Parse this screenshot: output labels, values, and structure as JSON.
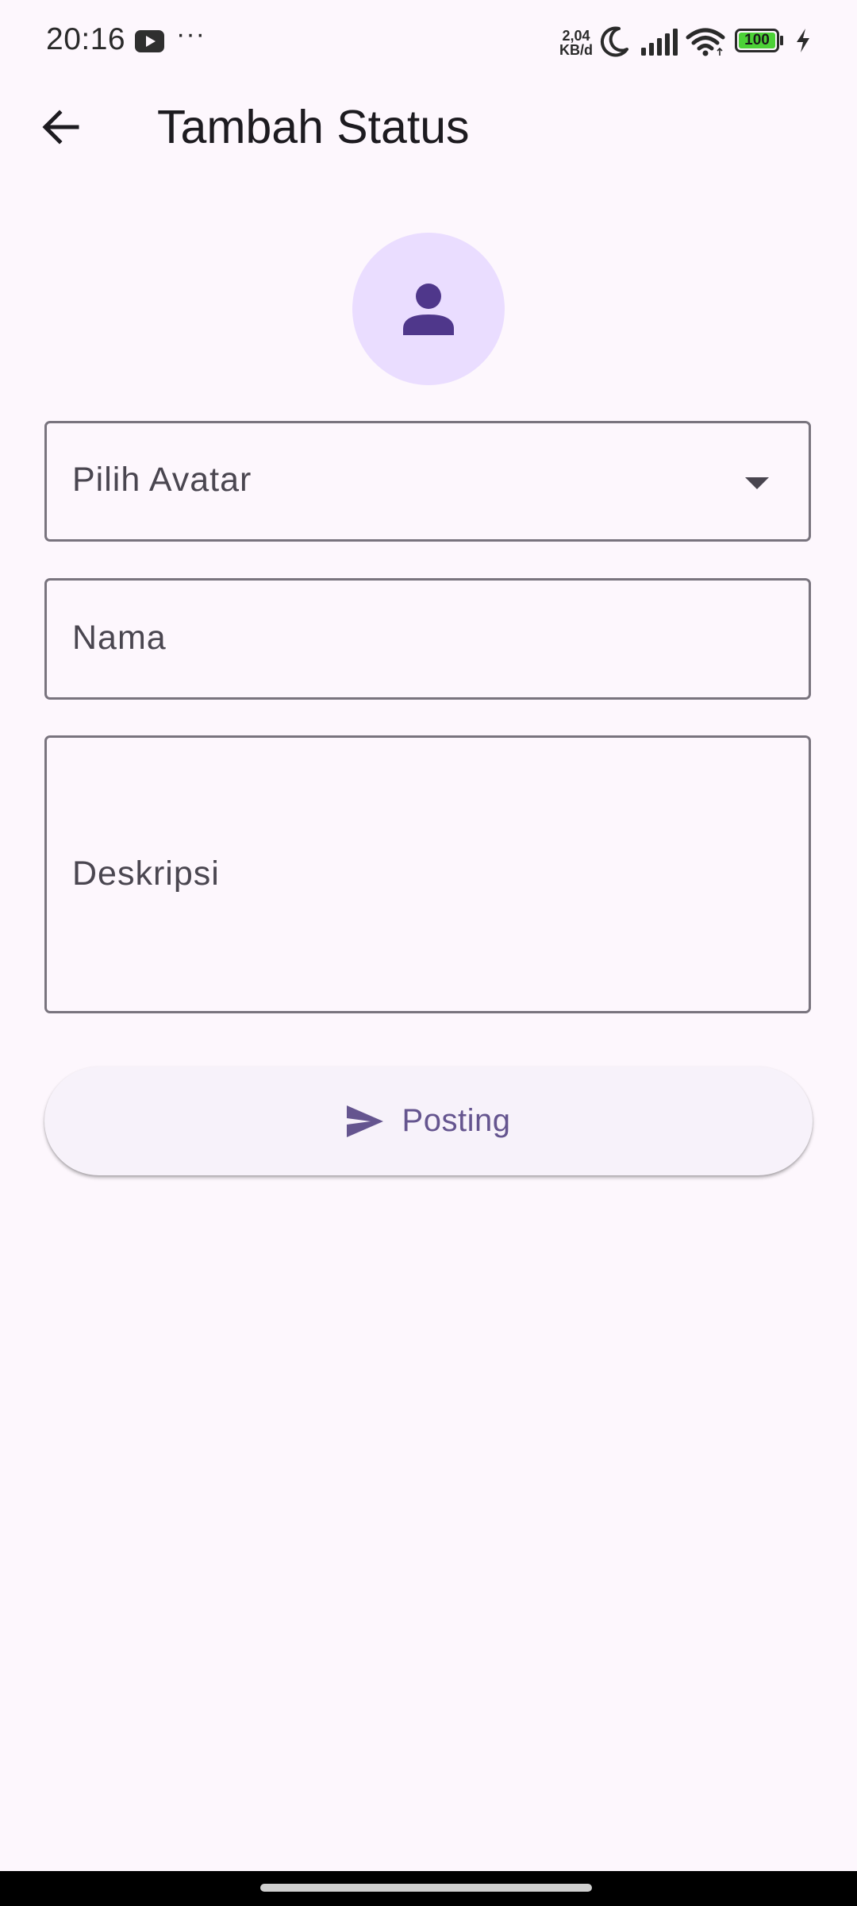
{
  "status_bar": {
    "time": "20:16",
    "more": "···",
    "net_speed_value": "2,04",
    "net_speed_unit": "KB/d",
    "battery": "100",
    "icons": [
      "youtube-icon",
      "moon-icon",
      "signal-icon",
      "wifi-icon",
      "battery-icon",
      "charging-icon"
    ]
  },
  "app_bar": {
    "back_icon": "arrow-back-icon",
    "title": "Tambah Status"
  },
  "avatar": {
    "icon": "person-icon",
    "background": "#EADDFF",
    "icon_color": "#4F378B"
  },
  "form": {
    "avatar_select_label": "Pilih Avatar",
    "name_label": "Nama",
    "description_label": "Deskripsi"
  },
  "post_button": {
    "icon": "send-icon",
    "label": "Posting",
    "color": "#65558F"
  },
  "theme": {
    "background": "#FDF7FD",
    "outline": "#79747E",
    "battery_fill": "#4CD137"
  }
}
